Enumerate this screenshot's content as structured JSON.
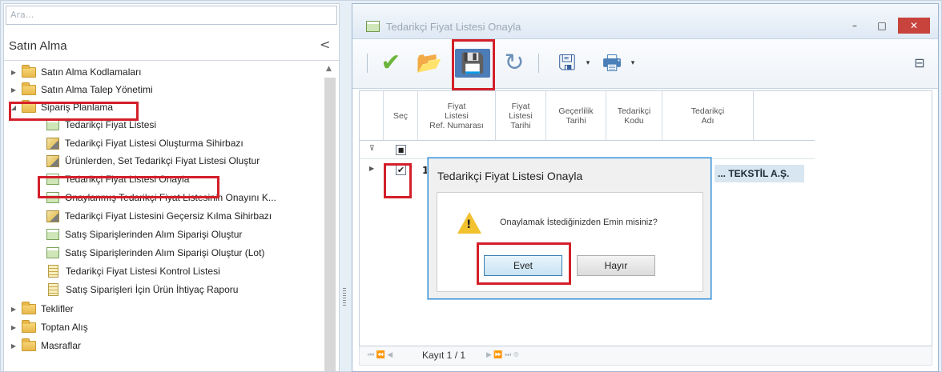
{
  "left_panel": {
    "search_placeholder": "Ara...",
    "title": "Satın Alma",
    "collapse_icon": "<",
    "tree": [
      {
        "label": "Satın Alma Kodlamaları",
        "type": "folder",
        "arrow": "▶"
      },
      {
        "label": "Satın Alma Talep Yönetimi",
        "type": "folder",
        "arrow": "▶"
      },
      {
        "label": "Sipariş Planlama",
        "type": "folder",
        "arrow": "◢"
      },
      {
        "label": "Tedarikçi Fiyat Listesi",
        "type": "form"
      },
      {
        "label": "Tedarikçi Fiyat Listesi Oluşturma Sihirbazı",
        "type": "wizard"
      },
      {
        "label": "Ürünlerden, Set Tedarikçi Fiyat Listesi Oluştur",
        "type": "wizard"
      },
      {
        "label": "Tedarikçi Fiyat Listesi Onayla",
        "type": "form"
      },
      {
        "label": "Onaylanmış Tedarikçi Fiyat Listesinin Onayını K...",
        "type": "form"
      },
      {
        "label": "Tedarikçi Fiyat Listesini Geçersiz Kılma Sihirbazı",
        "type": "wizard"
      },
      {
        "label": "Satış Siparişlerinden Alım Siparişi Oluştur",
        "type": "form"
      },
      {
        "label": "Satış Siparişlerinden Alım Siparişi Oluştur (Lot)",
        "type": "form"
      },
      {
        "label": "Tedarikçi Fiyat Listesi Kontrol Listesi",
        "type": "report"
      },
      {
        "label": "Satış Siparişleri İçin Ürün İhtiyaç Raporu",
        "type": "report"
      },
      {
        "label": "Teklifler",
        "type": "folder",
        "arrow": "▶"
      },
      {
        "label": "Toptan Alış",
        "type": "folder",
        "arrow": "▶"
      },
      {
        "label": "Masraflar",
        "type": "folder",
        "arrow": "▶"
      }
    ]
  },
  "window": {
    "title": "Tedarikçi Fiyat Listesi Onayla",
    "minimize": "–",
    "maximize": "□",
    "close": "✕",
    "toolbar": [
      {
        "icon": "approve-check-icon",
        "glyph": "✔",
        "color": "#6ab53a"
      },
      {
        "icon": "open-folder-icon",
        "glyph": "📂",
        "color": "#e3a93a"
      },
      {
        "icon": "save-disk-icon",
        "glyph": "💾",
        "color": "#355f9c"
      },
      {
        "icon": "refresh-icon",
        "glyph": "↻",
        "color": "#6b8fb8"
      },
      {
        "icon": "export-icon",
        "glyph": "🖫",
        "color": "#355f9c"
      },
      {
        "icon": "print-icon",
        "glyph": "🖶",
        "color": "#4a7fb8"
      }
    ],
    "grid": {
      "columns": [
        "",
        "Seç",
        "Fiyat\nListesi\nRef. Numarası",
        "Fiyat\nListesi\nTarihi",
        "Geçerlilik\nTarihi",
        "Tedarikçi\nKodu",
        "Tedarikçi\nAdı"
      ],
      "row": {
        "select_checked": "✔",
        "ref_number": "1",
        "supplier_name": "... TEKSTİL A.Ş."
      }
    },
    "navigator": {
      "prefix": "⏮ ⏪ ◀",
      "record_text": "Kayıt 1 / 1",
      "suffix": "▶ ⏩ ⏭ ⊕"
    }
  },
  "dialog": {
    "title": "Tedarikçi Fiyat Listesi Onayla",
    "message": "Onaylamak İstediğinizden Emin misiniz?",
    "yes_label": "Evet",
    "no_label": "Hayır"
  }
}
